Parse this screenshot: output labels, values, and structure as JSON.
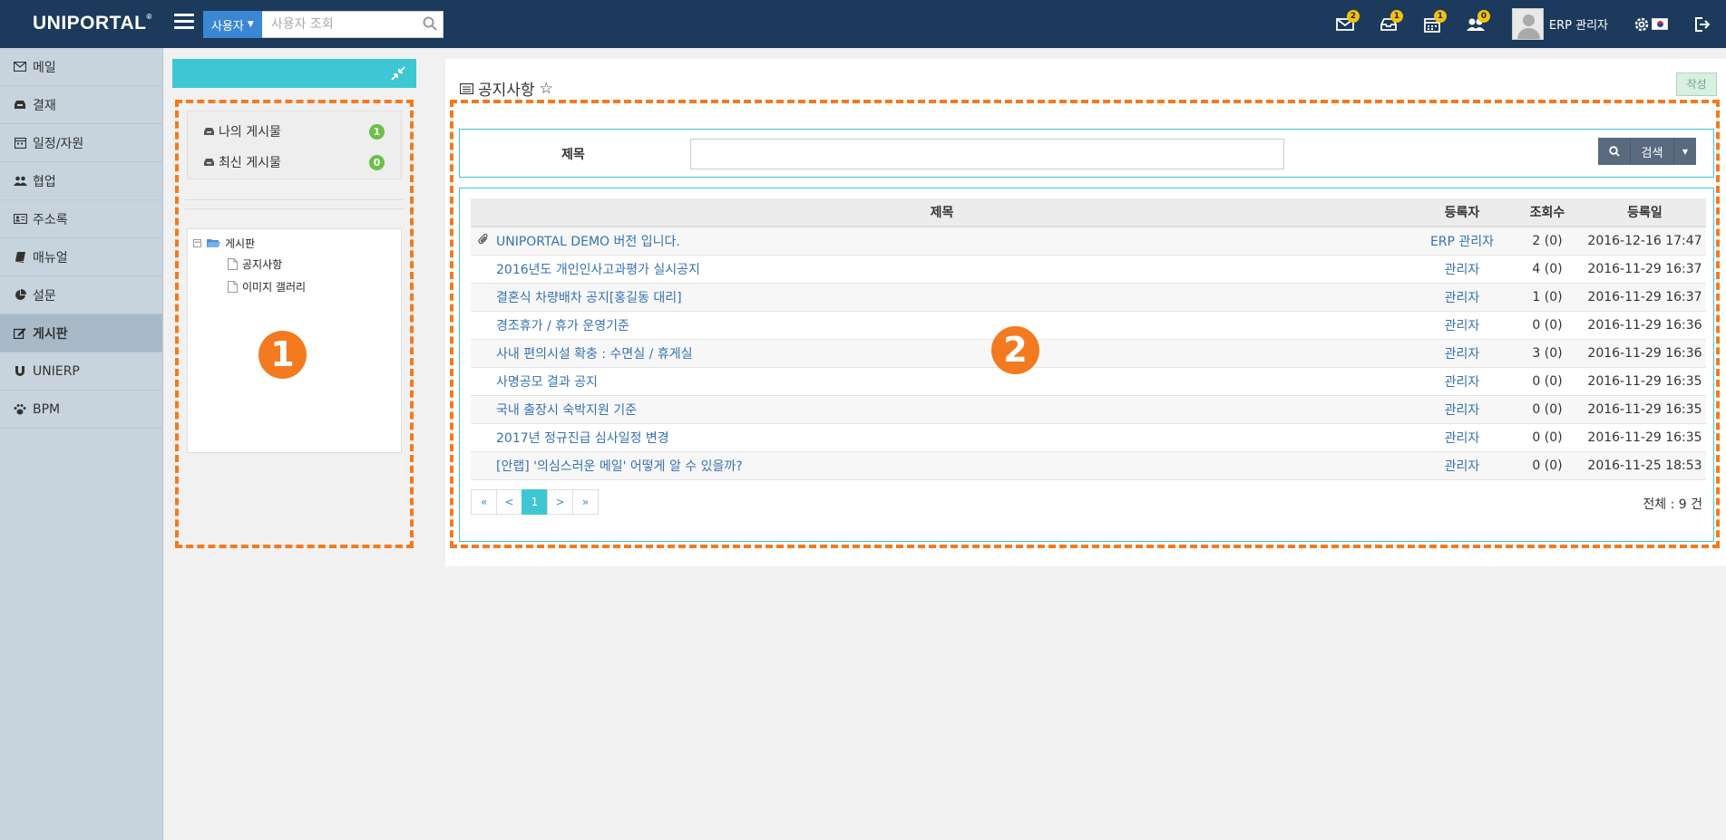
{
  "header": {
    "logo": "UNIPORTAL",
    "logo_mark": "®",
    "search_scope": "사용자",
    "search_placeholder": "사용자 조회",
    "badges": {
      "mail": "2",
      "approval": "1",
      "calendar": "1",
      "people": "0"
    },
    "username": "ERP 관리자"
  },
  "sidebar": {
    "items": [
      {
        "label": "메일",
        "icon": "envelope-icon"
      },
      {
        "label": "결재",
        "icon": "inbox-icon"
      },
      {
        "label": "일정/자원",
        "icon": "calendar-icon"
      },
      {
        "label": "협업",
        "icon": "users-icon"
      },
      {
        "label": "주소록",
        "icon": "address-card-icon"
      },
      {
        "label": "매뉴얼",
        "icon": "book-icon"
      },
      {
        "label": "설문",
        "icon": "pie-chart-icon"
      },
      {
        "label": "게시판",
        "icon": "edit-icon",
        "active": true
      },
      {
        "label": "UNIERP",
        "icon": "magnet-icon"
      },
      {
        "label": "BPM",
        "icon": "paw-icon"
      }
    ]
  },
  "left_panel": {
    "my_posts_label": "나의 게시물",
    "my_posts_count": "1",
    "recent_posts_label": "최신 게시물",
    "recent_posts_count": "0",
    "tree": {
      "root": "게시판",
      "children": [
        "공지사항",
        "이미지 갤러리"
      ]
    }
  },
  "main": {
    "title": "공지사항",
    "write_button": "작성",
    "search_label": "제목",
    "search_button": "검색",
    "columns": {
      "title": "제목",
      "author": "등록자",
      "views": "조회수",
      "date": "등록일"
    },
    "rows": [
      {
        "title": "UNIPORTAL DEMO 버전 입니다.",
        "author": "ERP 관리자",
        "views": "2 (0)",
        "date": "2016-12-16 17:47",
        "attachment": true
      },
      {
        "title": "2016년도 개인인사고과평가 실시공지",
        "author": "관리자",
        "views": "4 (0)",
        "date": "2016-11-29 16:37"
      },
      {
        "title": "결혼식 차량배차 공지[홍길동 대리]",
        "author": "관리자",
        "views": "1 (0)",
        "date": "2016-11-29 16:37"
      },
      {
        "title": "경조휴가 / 휴가 운영기준",
        "author": "관리자",
        "views": "0 (0)",
        "date": "2016-11-29 16:36"
      },
      {
        "title": "사내 편의시설 확충 : 수면실 / 휴게실",
        "author": "관리자",
        "views": "3 (0)",
        "date": "2016-11-29 16:36"
      },
      {
        "title": "사명공모 결과 공지",
        "author": "관리자",
        "views": "0 (0)",
        "date": "2016-11-29 16:35"
      },
      {
        "title": "국내 출장시 숙박지원 기준",
        "author": "관리자",
        "views": "0 (0)",
        "date": "2016-11-29 16:35"
      },
      {
        "title": "2017년 정규진급 심사일정 변경",
        "author": "관리자",
        "views": "0 (0)",
        "date": "2016-11-29 16:35"
      },
      {
        "title": "[안랩] '의심스러운 메일' 어떻게 알 수 있을까?",
        "author": "관리자",
        "views": "0 (0)",
        "date": "2016-11-25 18:53"
      }
    ],
    "pager": {
      "first": "«",
      "prev": "<",
      "current": "1",
      "next": ">",
      "last": "»"
    },
    "total": "전체 : 9 건"
  },
  "annotations": {
    "one": "1",
    "two": "2"
  },
  "colors": {
    "topbar": "#1b3a5c",
    "accent": "#3ec7d2",
    "annotation": "#f47a1f",
    "link": "#3672b1"
  }
}
